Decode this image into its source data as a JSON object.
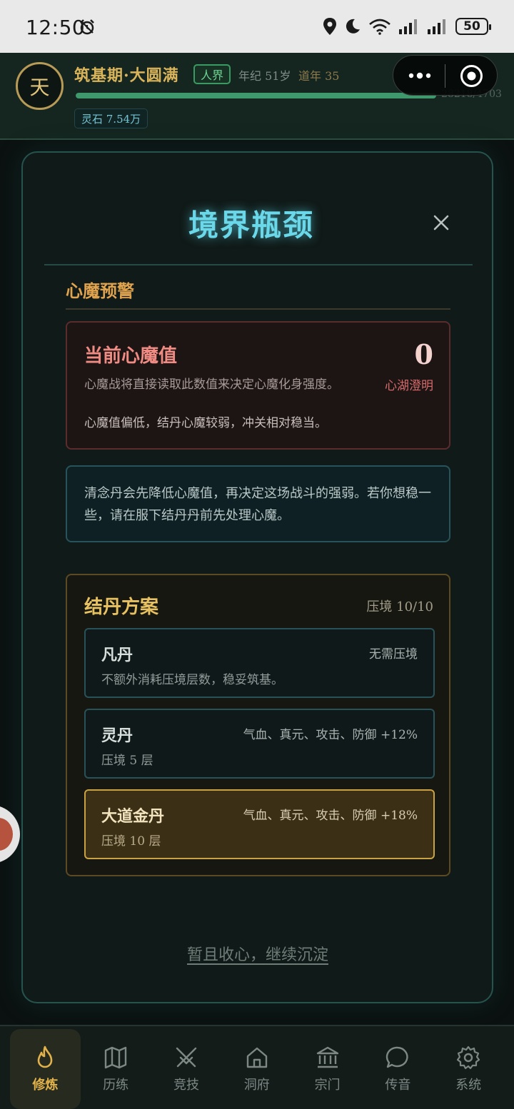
{
  "status_bar": {
    "time": "12:50",
    "battery": "50"
  },
  "header": {
    "avatar_char": "天",
    "realm": "筑基期·大圆满",
    "world": "人界",
    "age": "年纪 51岁",
    "dao": "道年 35",
    "xp_text": "28218/4703",
    "xp_fraction": 1.0,
    "spirit_stone": "灵石 7.54万"
  },
  "modal": {
    "title": "境界瓶颈",
    "section_label": "心魔预警",
    "demon": {
      "title": "当前心魔值",
      "value": "0",
      "desc": "心魔战将直接读取此数值来决定心魔化身强度。",
      "state": "心湖澄明",
      "note": "心魔值偏低，结丹心魔较弱，冲关相对稳当。"
    },
    "info": "清念丹会先降低心魔值，再决定这场战斗的强弱。若你想稳一些，请在服下结丹丹前先处理心魔。",
    "plan": {
      "title": "结丹方案",
      "count": "压境 10/10",
      "options": [
        {
          "name": "凡丹",
          "tag": "无需压境",
          "desc": "不额外消耗压境层数，稳妥筑基。",
          "selected": false
        },
        {
          "name": "灵丹",
          "tag": "气血、真元、攻击、防御 +12%",
          "desc": "压境 5 层",
          "selected": false
        },
        {
          "name": "大道金丹",
          "tag": "气血、真元、攻击、防御 +18%",
          "desc": "压境 10 层",
          "selected": true
        }
      ]
    },
    "dismiss": "暂且收心，继续沉淀"
  },
  "nav": [
    {
      "label": "修炼",
      "icon": "flame-icon",
      "active": true
    },
    {
      "label": "历练",
      "icon": "map-icon",
      "active": false
    },
    {
      "label": "竞技",
      "icon": "swords-icon",
      "active": false
    },
    {
      "label": "洞府",
      "icon": "home-icon",
      "active": false
    },
    {
      "label": "宗门",
      "icon": "temple-icon",
      "active": false
    },
    {
      "label": "传音",
      "icon": "chat-bubble-icon",
      "active": false
    },
    {
      "label": "系统",
      "icon": "gear-icon",
      "active": false
    }
  ],
  "colors": {
    "accent_gold": "#e2b24b",
    "title_cyan": "#6bd8ea",
    "demon_red": "#f08b84"
  }
}
